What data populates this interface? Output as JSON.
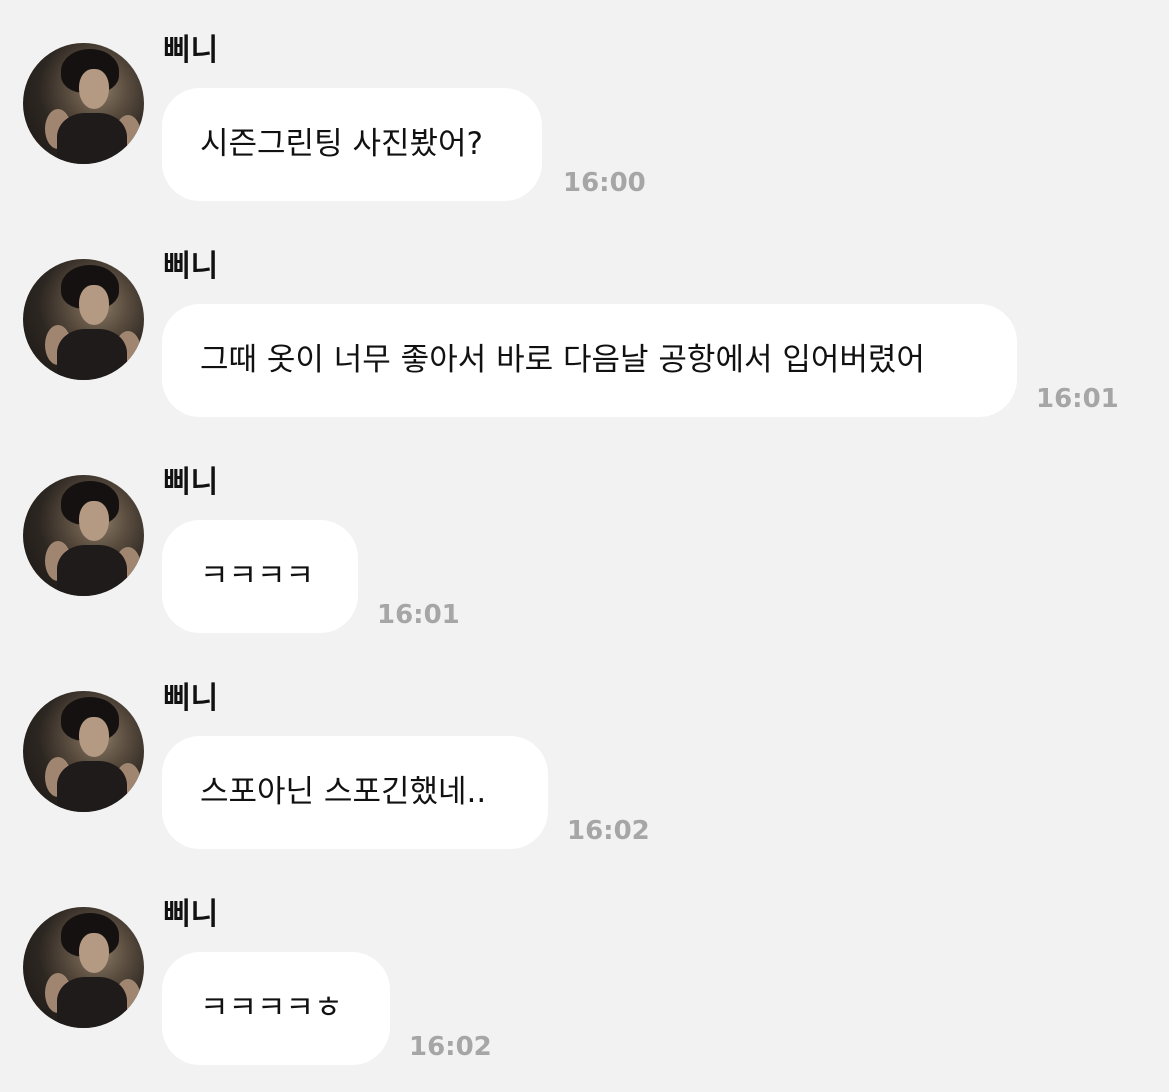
{
  "messages": [
    {
      "sender": "삐니",
      "text": "시즌그린팅 사진봤어?",
      "time": "16:00"
    },
    {
      "sender": "삐니",
      "text": "그때 옷이 너무 좋아서 바로 다음날 공항에서 입어버렸어",
      "time": "16:01"
    },
    {
      "sender": "삐니",
      "text": "ㅋㅋㅋㅋ",
      "time": "16:01"
    },
    {
      "sender": "삐니",
      "text": "스포아닌 스포긴했네..",
      "time": "16:02"
    },
    {
      "sender": "삐니",
      "text": "ㅋㅋㅋㅋㅎ",
      "time": "16:02"
    }
  ]
}
